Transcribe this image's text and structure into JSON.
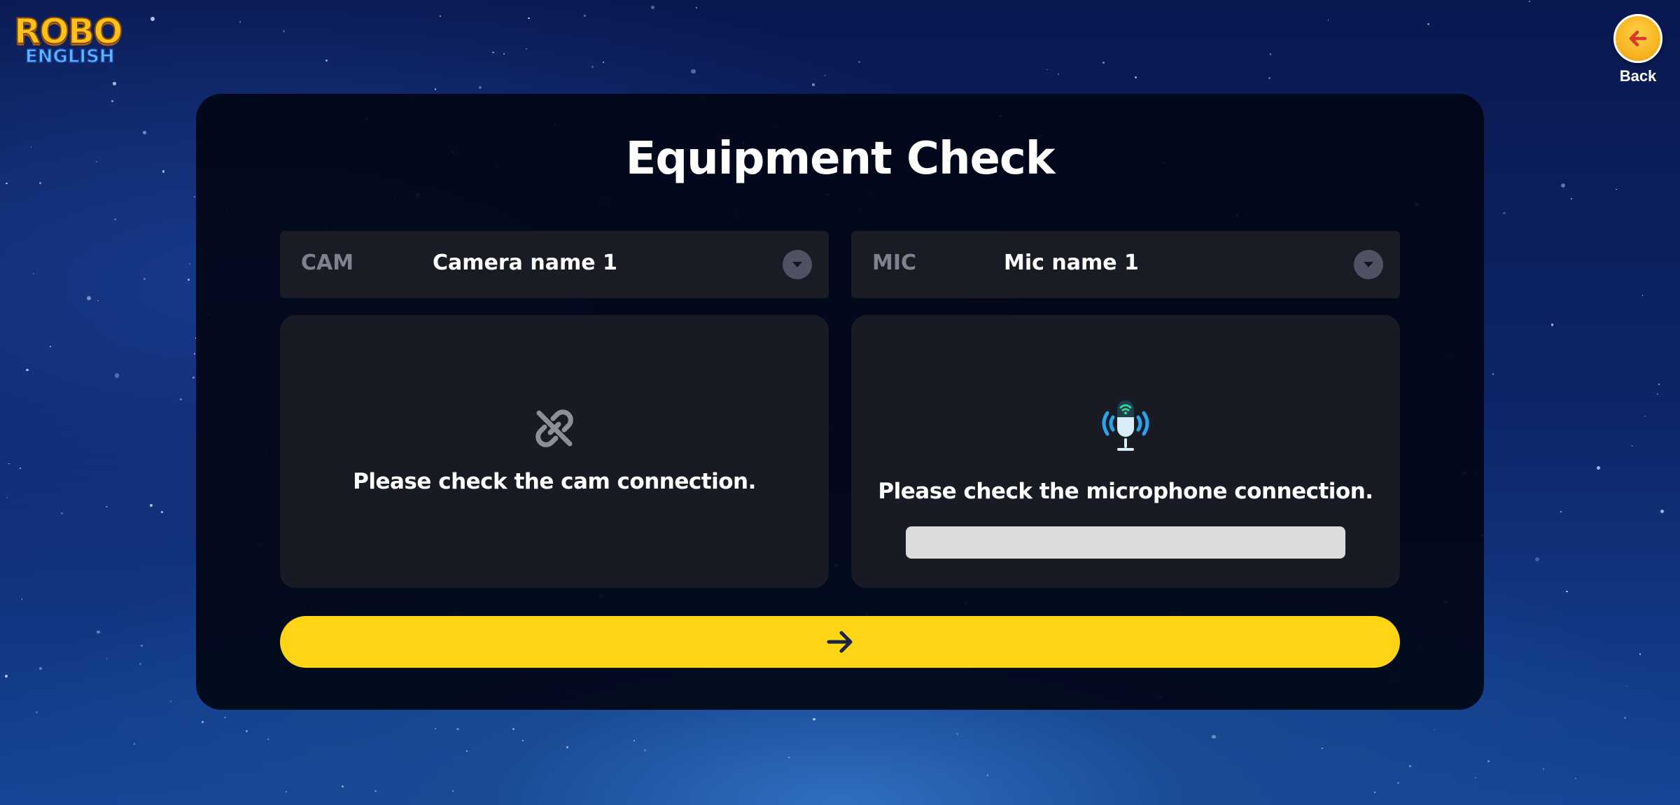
{
  "logo": {
    "line1": "ROBO",
    "line2": "ENGLISH"
  },
  "back": {
    "label": "Back"
  },
  "title": "Equipment Check",
  "camera": {
    "tag": "CAM",
    "selected": "Camera name 1",
    "message": "Please check the cam connection.",
    "status_icon": "link-broken-icon"
  },
  "microphone": {
    "tag": "MIC",
    "selected": "Mic name 1",
    "message": "Please check the microphone connection.",
    "status_icon": "microphone-icon",
    "level": 0
  },
  "next": {
    "icon": "arrow-right-icon"
  },
  "colors": {
    "accent": "#ffd415",
    "panel": "#02061a",
    "card": "#181b24",
    "select": "#1a1c25",
    "muted_text": "#7f828e"
  }
}
